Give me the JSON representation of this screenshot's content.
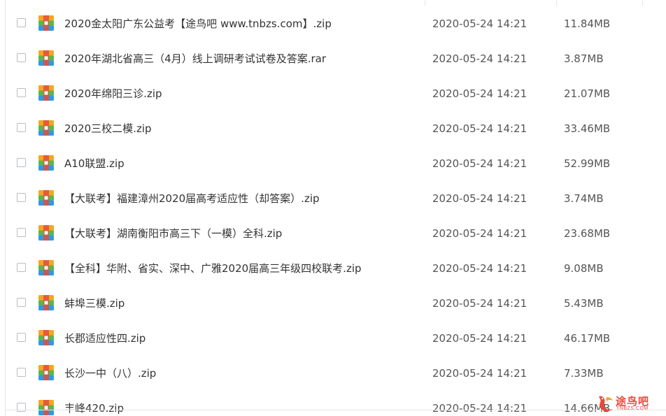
{
  "colors": {
    "icon_orange": "#f5a623",
    "icon_green": "#59b84c",
    "icon_blue": "#2f9be0",
    "icon_band": "#e14f3e",
    "watermark_red": "#e84a3a"
  },
  "icons": {
    "checkbox": "checkbox-icon",
    "archive": "archive-file-icon",
    "watermark": "bird-logo-icon"
  },
  "files": [
    {
      "name": "2020金太阳广东公益考【途鸟吧 www.tnbzs.com】.zip",
      "date": "2020-05-24 14:21",
      "size": "11.84MB"
    },
    {
      "name": "2020年湖北省高三（4月）线上调研考试试卷及答案.rar",
      "date": "2020-05-24 14:21",
      "size": "3.87MB"
    },
    {
      "name": "2020年绵阳三诊.zip",
      "date": "2020-05-24 14:21",
      "size": "21.07MB"
    },
    {
      "name": "2020三校二模.zip",
      "date": "2020-05-24 14:21",
      "size": "33.46MB"
    },
    {
      "name": "A10联盟.zip",
      "date": "2020-05-24 14:21",
      "size": "52.99MB"
    },
    {
      "name": "【大联考】福建漳州2020届高考适应性（却答案）.zip",
      "date": "2020-05-24 14:21",
      "size": "3.74MB"
    },
    {
      "name": "【大联考】湖南衡阳市高三下（一模）全科.zip",
      "date": "2020-05-24 14:21",
      "size": "23.68MB"
    },
    {
      "name": "【全科】华附、省实、深中、广雅2020届高三年级四校联考.zip",
      "date": "2020-05-24 14:21",
      "size": "9.08MB"
    },
    {
      "name": "蚌埠三模.zip",
      "date": "2020-05-24 14:21",
      "size": "5.43MB"
    },
    {
      "name": "长郡适应性四.zip",
      "date": "2020-05-24 14:21",
      "size": "46.17MB"
    },
    {
      "name": "长沙一中（八）.zip",
      "date": "2020-05-24 14:21",
      "size": "7.33MB"
    },
    {
      "name": "丰峰420.zip",
      "date": "2020-05-24 14:21",
      "size": "14.66MB"
    }
  ],
  "watermark": {
    "title": "途鸟吧",
    "subtitle": "TNBZS.COM"
  }
}
